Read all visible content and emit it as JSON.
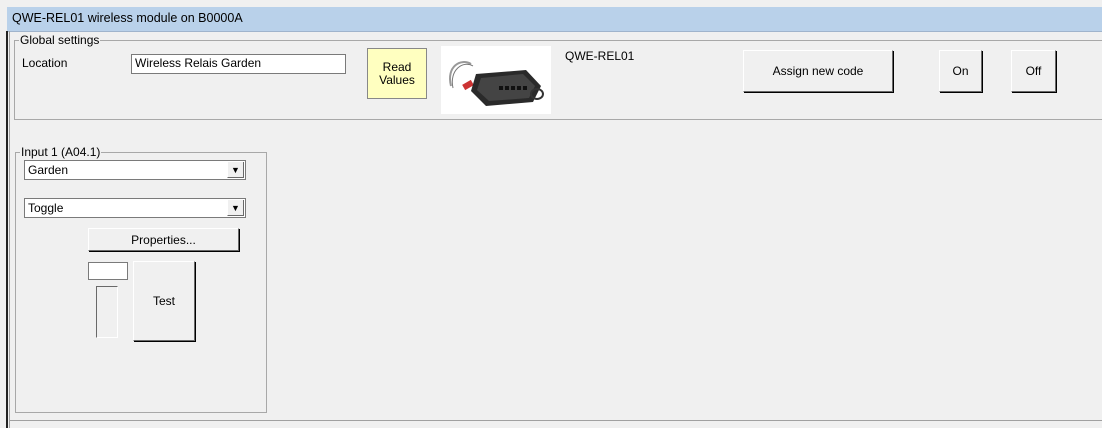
{
  "window": {
    "title": "QWE-REL01 wireless module on B0000A"
  },
  "global": {
    "group_title": "Global settings",
    "location_label": "Location",
    "location_value": "Wireless Relais Garden",
    "read_values_line1": "Read",
    "read_values_line2": "Values",
    "module_name": "QWE-REL01",
    "assign_label": "Assign new code",
    "on_label": "On",
    "off_label": "Off"
  },
  "input1": {
    "group_title": "Input 1 (A04.1)",
    "name_value": "Garden",
    "mode_value": "Toggle",
    "properties_label": "Properties...",
    "test_label": "Test"
  },
  "colors": {
    "titlebar": "#b9d1ea",
    "read_button": "#ffffc0",
    "window": "#f0f0f0"
  }
}
